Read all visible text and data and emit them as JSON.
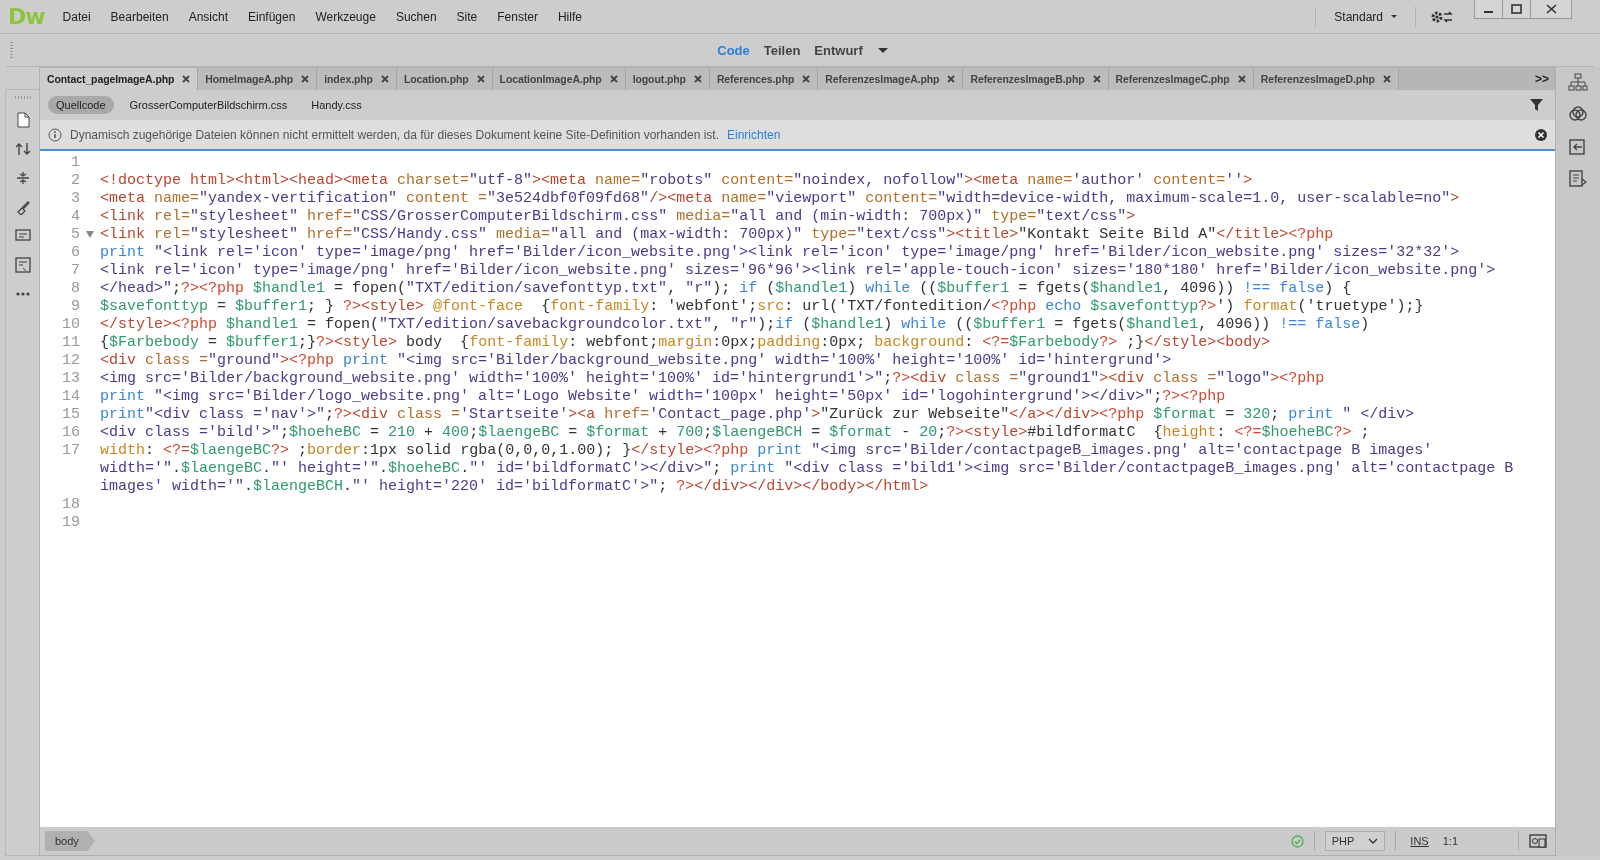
{
  "app": {
    "logo": "Dw"
  },
  "menu": [
    "Datei",
    "Bearbeiten",
    "Ansicht",
    "Einfügen",
    "Werkzeuge",
    "Suchen",
    "Site",
    "Fenster",
    "Hilfe"
  ],
  "workspace": {
    "label": "Standard"
  },
  "view_switch": [
    {
      "label": "Code",
      "selected": true
    },
    {
      "label": "Teilen",
      "selected": false
    },
    {
      "label": "Entwurf",
      "selected": false
    }
  ],
  "file_tabs": [
    {
      "label": "Contact_pageImageA.php",
      "selected": true
    },
    {
      "label": "HomeImageA.php",
      "selected": false
    },
    {
      "label": "index.php",
      "selected": false
    },
    {
      "label": "Location.php",
      "selected": false
    },
    {
      "label": "LocationImageA.php",
      "selected": false
    },
    {
      "label": "logout.php",
      "selected": false
    },
    {
      "label": "References.php",
      "selected": false
    },
    {
      "label": "ReferenzesImageA.php",
      "selected": false
    },
    {
      "label": "ReferenzesImageB.php",
      "selected": false
    },
    {
      "label": "ReferenzesImageC.php",
      "selected": false
    },
    {
      "label": "ReferenzesImageD.php",
      "selected": false
    }
  ],
  "tab_overflow": ">>",
  "related_files": [
    {
      "label": "Quellcode",
      "selected": true
    },
    {
      "label": "GrosserComputerBildschirm.css",
      "selected": false
    },
    {
      "label": "Handy.css",
      "selected": false
    }
  ],
  "info_bar": {
    "message": "Dynamisch zugehörige Dateien können nicht ermittelt werden, da für dieses Dokument keine Site-Definition vorhanden ist.",
    "link": "Einrichten"
  },
  "code_lines": [
    {
      "number": "1"
    },
    {
      "number": "2",
      "tokens": [
        {
          "kind": "tag",
          "text": "<!doctype html><html><head><meta "
        },
        {
          "kind": "attr",
          "text": "charset="
        },
        {
          "kind": "str",
          "text": "\"utf-8\""
        },
        {
          "kind": "tag",
          "text": "><meta "
        },
        {
          "kind": "attr",
          "text": "name="
        },
        {
          "kind": "str",
          "text": "\"robots\" "
        },
        {
          "kind": "attr",
          "text": "content="
        },
        {
          "kind": "str",
          "text": "\"noindex, nofollow\""
        },
        {
          "kind": "tag",
          "text": "><meta "
        },
        {
          "kind": "attr",
          "text": "name="
        },
        {
          "kind": "str",
          "text": "'author' "
        },
        {
          "kind": "attr",
          "text": "content="
        },
        {
          "kind": "str",
          "text": "''"
        },
        {
          "kind": "tag",
          "text": ">"
        }
      ]
    },
    {
      "number": "3",
      "tokens": [
        {
          "kind": "tag",
          "text": "<meta "
        },
        {
          "kind": "attr",
          "text": "name="
        },
        {
          "kind": "str",
          "text": "\"yandex-vertification\" "
        },
        {
          "kind": "attr",
          "text": "content ="
        },
        {
          "kind": "str",
          "text": "\"3e524dbf0f09fd68\""
        },
        {
          "kind": "tag",
          "text": "/><meta "
        },
        {
          "kind": "attr",
          "text": "name="
        },
        {
          "kind": "str",
          "text": "\"viewport\" "
        },
        {
          "kind": "attr",
          "text": "content="
        },
        {
          "kind": "str",
          "text": "\"width=device-width, maximum-scale=1.0, user-scalable=no\""
        },
        {
          "kind": "tag",
          "text": ">"
        }
      ]
    },
    {
      "number": "4",
      "tokens": [
        {
          "kind": "tag",
          "text": "<link "
        },
        {
          "kind": "attr",
          "text": "rel="
        },
        {
          "kind": "str",
          "text": "\"stylesheet\" "
        },
        {
          "kind": "attr",
          "text": "href="
        },
        {
          "kind": "str",
          "text": "\"CSS/GrosserComputerBildschirm.css\" "
        },
        {
          "kind": "attr",
          "text": "media="
        },
        {
          "kind": "str",
          "text": "\"all and (min-width: 700px)\" "
        },
        {
          "kind": "attr",
          "text": "type="
        },
        {
          "kind": "str",
          "text": "\"text/css\""
        },
        {
          "kind": "tag",
          "text": ">"
        }
      ]
    },
    {
      "number": "5",
      "expanded": true,
      "tokens": [
        {
          "kind": "tag",
          "text": "<link "
        },
        {
          "kind": "attr",
          "text": "rel="
        },
        {
          "kind": "str",
          "text": "\"stylesheet\" "
        },
        {
          "kind": "attr",
          "text": "href="
        },
        {
          "kind": "str",
          "text": "\"CSS/Handy.css\" "
        },
        {
          "kind": "attr",
          "text": "media="
        },
        {
          "kind": "str",
          "text": "\"all and (max-width: 700px)\" "
        },
        {
          "kind": "attr",
          "text": "type="
        },
        {
          "kind": "str",
          "text": "\"text/css\""
        },
        {
          "kind": "tag",
          "text": "><title>"
        },
        {
          "kind": "plain",
          "text": "\"Kontakt Seite Bild A\""
        },
        {
          "kind": "tag",
          "text": "</title>"
        },
        {
          "kind": "php",
          "text": "<?php"
        }
      ]
    },
    {
      "number": "6",
      "tokens": [
        {
          "kind": "kw",
          "text": "print "
        },
        {
          "kind": "str",
          "text": "\"<link rel='icon' type='image/png' href='Bilder/icon_website.png'><link rel='icon' type='image/png' href='Bilder/icon_website.png' sizes='32*32'>"
        }
      ]
    },
    {
      "number": "7",
      "tokens": [
        {
          "kind": "str",
          "text": "<link rel='icon' type='image/png' href='Bilder/icon_website.png' sizes='96*96'><link rel='apple-touch-icon' sizes='180*180' href='Bilder/icon_website.png'>"
        }
      ]
    },
    {
      "number": "8",
      "tokens": [
        {
          "kind": "str",
          "text": "</head>\""
        },
        {
          "kind": "plain",
          "text": ";"
        },
        {
          "kind": "php",
          "text": "?><?php "
        },
        {
          "kind": "var",
          "text": "$handle1"
        },
        {
          "kind": "plain",
          "text": " = fopen("
        },
        {
          "kind": "str",
          "text": "\"TXT/edition/savefonttyp.txt\""
        },
        {
          "kind": "plain",
          "text": ", "
        },
        {
          "kind": "str",
          "text": "\"r\""
        },
        {
          "kind": "plain",
          "text": "); "
        },
        {
          "kind": "kw",
          "text": "if "
        },
        {
          "kind": "plain",
          "text": "("
        },
        {
          "kind": "var",
          "text": "$handle1"
        },
        {
          "kind": "plain",
          "text": ") "
        },
        {
          "kind": "kw",
          "text": "while "
        },
        {
          "kind": "plain",
          "text": "(("
        },
        {
          "kind": "var",
          "text": "$buffer1"
        },
        {
          "kind": "plain",
          "text": " = fgets("
        },
        {
          "kind": "var",
          "text": "$handle1"
        },
        {
          "kind": "plain",
          "text": ", 4096)) "
        },
        {
          "kind": "kw",
          "text": "!== false"
        },
        {
          "kind": "plain",
          "text": ") {"
        }
      ]
    },
    {
      "number": "9",
      "tokens": [
        {
          "kind": "var",
          "text": "$savefonttyp"
        },
        {
          "kind": "plain",
          "text": " = "
        },
        {
          "kind": "var",
          "text": "$buffer1"
        },
        {
          "kind": "plain",
          "text": "; } "
        },
        {
          "kind": "php",
          "text": "?>"
        },
        {
          "kind": "tag",
          "text": "<style> "
        },
        {
          "kind": "css",
          "text": "@font-face  "
        },
        {
          "kind": "plain",
          "text": "{"
        },
        {
          "kind": "css",
          "text": "font-family"
        },
        {
          "kind": "plain",
          "text": ": 'webfont';"
        },
        {
          "kind": "css",
          "text": "src"
        },
        {
          "kind": "plain",
          "text": ": url('TXT/fontedition/"
        },
        {
          "kind": "php",
          "text": "<?php "
        },
        {
          "kind": "kw",
          "text": "echo "
        },
        {
          "kind": "var",
          "text": "$savefonttyp"
        },
        {
          "kind": "php",
          "text": "?>"
        },
        {
          "kind": "plain",
          "text": "') "
        },
        {
          "kind": "css",
          "text": "format"
        },
        {
          "kind": "plain",
          "text": "('truetype');}"
        }
      ]
    },
    {
      "number": "10",
      "tokens": [
        {
          "kind": "tag",
          "text": "</style>"
        },
        {
          "kind": "php",
          "text": "<?php "
        },
        {
          "kind": "var",
          "text": "$handle1"
        },
        {
          "kind": "plain",
          "text": " = fopen("
        },
        {
          "kind": "str",
          "text": "\"TXT/edition/savebackgroundcolor.txt\""
        },
        {
          "kind": "plain",
          "text": ", "
        },
        {
          "kind": "str",
          "text": "\"r\""
        },
        {
          "kind": "plain",
          "text": ");"
        },
        {
          "kind": "kw",
          "text": "if "
        },
        {
          "kind": "plain",
          "text": "("
        },
        {
          "kind": "var",
          "text": "$handle1"
        },
        {
          "kind": "plain",
          "text": ") "
        },
        {
          "kind": "kw",
          "text": "while "
        },
        {
          "kind": "plain",
          "text": "(("
        },
        {
          "kind": "var",
          "text": "$buffer1"
        },
        {
          "kind": "plain",
          "text": " = fgets("
        },
        {
          "kind": "var",
          "text": "$handle1"
        },
        {
          "kind": "plain",
          "text": ", 4096)) "
        },
        {
          "kind": "kw",
          "text": "!== false"
        },
        {
          "kind": "plain",
          "text": ")"
        }
      ]
    },
    {
      "number": "11",
      "tokens": [
        {
          "kind": "plain",
          "text": "{"
        },
        {
          "kind": "var",
          "text": "$Farbebody"
        },
        {
          "kind": "plain",
          "text": " = "
        },
        {
          "kind": "var",
          "text": "$buffer1"
        },
        {
          "kind": "plain",
          "text": ";}"
        },
        {
          "kind": "php",
          "text": "?>"
        },
        {
          "kind": "tag",
          "text": "<style> "
        },
        {
          "kind": "plain",
          "text": "body  {"
        },
        {
          "kind": "css",
          "text": "font-family"
        },
        {
          "kind": "plain",
          "text": ": webfont;"
        },
        {
          "kind": "css",
          "text": "margin"
        },
        {
          "kind": "plain",
          "text": ":0px;"
        },
        {
          "kind": "css",
          "text": "padding"
        },
        {
          "kind": "plain",
          "text": ":0px; "
        },
        {
          "kind": "css",
          "text": "background"
        },
        {
          "kind": "plain",
          "text": ": "
        },
        {
          "kind": "php",
          "text": "<?="
        },
        {
          "kind": "var",
          "text": "$Farbebody"
        },
        {
          "kind": "php",
          "text": "?>"
        },
        {
          "kind": "plain",
          "text": " ;}"
        },
        {
          "kind": "tag",
          "text": "</style><body>"
        }
      ]
    },
    {
      "number": "12",
      "tokens": [
        {
          "kind": "tag",
          "text": "<div "
        },
        {
          "kind": "attr",
          "text": "class ="
        },
        {
          "kind": "str",
          "text": "\"ground\""
        },
        {
          "kind": "tag",
          "text": ">"
        },
        {
          "kind": "php",
          "text": "<?php "
        },
        {
          "kind": "kw",
          "text": "print "
        },
        {
          "kind": "str",
          "text": "\"<img src='Bilder/background_website.png' width='100%' height='100%' id='hintergrund'>"
        }
      ]
    },
    {
      "number": "13",
      "tokens": [
        {
          "kind": "str",
          "text": "<img src='Bilder/background_website.png' width='100%' height='100%' id='hintergrund1'>\""
        },
        {
          "kind": "plain",
          "text": ";"
        },
        {
          "kind": "php",
          "text": "?>"
        },
        {
          "kind": "tag",
          "text": "<div "
        },
        {
          "kind": "attr",
          "text": "class ="
        },
        {
          "kind": "str",
          "text": "\"ground1\""
        },
        {
          "kind": "tag",
          "text": "><div "
        },
        {
          "kind": "attr",
          "text": "class ="
        },
        {
          "kind": "str",
          "text": "\"logo\""
        },
        {
          "kind": "tag",
          "text": ">"
        },
        {
          "kind": "php",
          "text": "<?php"
        }
      ]
    },
    {
      "number": "14",
      "tokens": [
        {
          "kind": "kw",
          "text": "print "
        },
        {
          "kind": "str",
          "text": "\"<img src='Bilder/logo_website.png' alt='Logo Website' width='100px' height='50px' id='logohintergrund'></div>\""
        },
        {
          "kind": "plain",
          "text": ";"
        },
        {
          "kind": "php",
          "text": "?><?php"
        }
      ]
    },
    {
      "number": "15",
      "tokens": [
        {
          "kind": "kw",
          "text": "print"
        },
        {
          "kind": "str",
          "text": "\"<div class ='nav'>\""
        },
        {
          "kind": "plain",
          "text": ";"
        },
        {
          "kind": "php",
          "text": "?>"
        },
        {
          "kind": "tag",
          "text": "<div "
        },
        {
          "kind": "attr",
          "text": "class ="
        },
        {
          "kind": "str",
          "text": "'Startseite'"
        },
        {
          "kind": "tag",
          "text": "><a "
        },
        {
          "kind": "attr",
          "text": "href="
        },
        {
          "kind": "str",
          "text": "'Contact_page.php'"
        },
        {
          "kind": "tag",
          "text": ">"
        },
        {
          "kind": "plain",
          "text": "\"Zurück zur Webseite\""
        },
        {
          "kind": "tag",
          "text": "</a></div>"
        },
        {
          "kind": "php",
          "text": "<?php "
        },
        {
          "kind": "var",
          "text": "$format"
        },
        {
          "kind": "plain",
          "text": " = "
        },
        {
          "kind": "num",
          "text": "320"
        },
        {
          "kind": "plain",
          "text": "; "
        },
        {
          "kind": "kw",
          "text": "print "
        },
        {
          "kind": "str",
          "text": "\" </div>"
        }
      ]
    },
    {
      "number": "16",
      "tokens": [
        {
          "kind": "str",
          "text": "<div class ='bild'>\""
        },
        {
          "kind": "plain",
          "text": ";"
        },
        {
          "kind": "var",
          "text": "$hoeheBC"
        },
        {
          "kind": "plain",
          "text": " = "
        },
        {
          "kind": "num",
          "text": "210"
        },
        {
          "kind": "plain",
          "text": " + "
        },
        {
          "kind": "num",
          "text": "400"
        },
        {
          "kind": "plain",
          "text": ";"
        },
        {
          "kind": "var",
          "text": "$laengeBC"
        },
        {
          "kind": "plain",
          "text": " = "
        },
        {
          "kind": "var",
          "text": "$format"
        },
        {
          "kind": "plain",
          "text": " + "
        },
        {
          "kind": "num",
          "text": "700"
        },
        {
          "kind": "plain",
          "text": ";"
        },
        {
          "kind": "var",
          "text": "$laengeBCH"
        },
        {
          "kind": "plain",
          "text": " = "
        },
        {
          "kind": "var",
          "text": "$format"
        },
        {
          "kind": "plain",
          "text": " - "
        },
        {
          "kind": "num",
          "text": "20"
        },
        {
          "kind": "plain",
          "text": ";"
        },
        {
          "kind": "php",
          "text": "?>"
        },
        {
          "kind": "tag",
          "text": "<style>"
        },
        {
          "kind": "plain",
          "text": "#bildformatC  {"
        },
        {
          "kind": "css",
          "text": "height"
        },
        {
          "kind": "plain",
          "text": ": "
        },
        {
          "kind": "php",
          "text": "<?="
        },
        {
          "kind": "var",
          "text": "$hoeheBC"
        },
        {
          "kind": "php",
          "text": "?>"
        },
        {
          "kind": "plain",
          "text": " ;"
        }
      ]
    },
    {
      "number": "17",
      "tokens": [
        {
          "kind": "css",
          "text": "width"
        },
        {
          "kind": "plain",
          "text": ": "
        },
        {
          "kind": "php",
          "text": "<?="
        },
        {
          "kind": "var",
          "text": "$laengeBC"
        },
        {
          "kind": "php",
          "text": "?>"
        },
        {
          "kind": "plain",
          "text": " ;"
        },
        {
          "kind": "css",
          "text": "border"
        },
        {
          "kind": "plain",
          "text": ":1px solid rgba(0,0,0,1.00); }"
        },
        {
          "kind": "tag",
          "text": "</style>"
        },
        {
          "kind": "php",
          "text": "<?php "
        },
        {
          "kind": "kw",
          "text": "print "
        },
        {
          "kind": "str",
          "text": "\"<img src='Bilder/contactpageB_images.png' alt='contactpage B images' width='\""
        },
        {
          "kind": "plain",
          "text": "."
        },
        {
          "kind": "var",
          "text": "$laengeBC"
        },
        {
          "kind": "plain",
          "text": "."
        },
        {
          "kind": "str",
          "text": "\"' height='\""
        },
        {
          "kind": "plain",
          "text": "."
        },
        {
          "kind": "var",
          "text": "$hoeheBC"
        },
        {
          "kind": "plain",
          "text": "."
        },
        {
          "kind": "str",
          "text": "\"' id='bildformatC'></div>\""
        },
        {
          "kind": "plain",
          "text": "; "
        },
        {
          "kind": "kw",
          "text": "print "
        },
        {
          "kind": "str",
          "text": "\"<div class ='bild1'><img src='Bilder/contactpageB_images.png' alt='contactpage B images' width='\""
        },
        {
          "kind": "plain",
          "text": "."
        },
        {
          "kind": "var",
          "text": "$laengeBCH"
        },
        {
          "kind": "plain",
          "text": "."
        },
        {
          "kind": "str",
          "text": "\"' height='220' id='bildformatC'>\""
        },
        {
          "kind": "plain",
          "text": "; "
        },
        {
          "kind": "php",
          "text": "?>"
        },
        {
          "kind": "tag",
          "text": "</div></div></body></html>"
        }
      ]
    },
    {
      "number": "18"
    },
    {
      "number": "19"
    }
  ],
  "status_bar": {
    "tag": "body",
    "language": "PHP",
    "mode": "INS",
    "position": "1:1"
  }
}
